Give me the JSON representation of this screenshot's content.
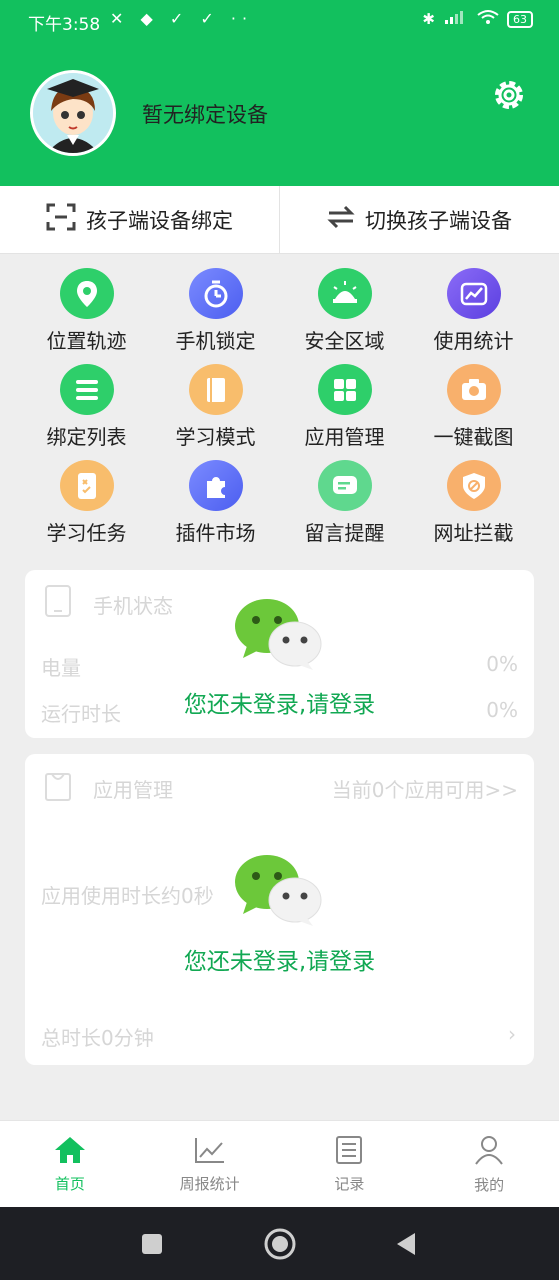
{
  "status": {
    "time": "下午3:58",
    "left_icons": "✕ ◆ ✓ ✓ ··",
    "battery": "63"
  },
  "header": {
    "device_title": "暂无绑定设备",
    "accent": "#12c05e"
  },
  "bind": {
    "bind_label": "孩子端设备绑定",
    "switch_label": "切换孩子端设备"
  },
  "features": [
    {
      "label": "位置轨迹",
      "icon": "location-pin-icon"
    },
    {
      "label": "手机锁定",
      "icon": "timer-icon"
    },
    {
      "label": "安全区域",
      "icon": "radar-icon"
    },
    {
      "label": "使用统计",
      "icon": "trend-chart-icon"
    },
    {
      "label": "绑定列表",
      "icon": "list-icon"
    },
    {
      "label": "学习模式",
      "icon": "book-icon"
    },
    {
      "label": "应用管理",
      "icon": "app-grid-icon"
    },
    {
      "label": "一键截图",
      "icon": "camera-icon"
    },
    {
      "label": "学习任务",
      "icon": "task-note-icon"
    },
    {
      "label": "插件市场",
      "icon": "puzzle-icon"
    },
    {
      "label": "留言提醒",
      "icon": "message-icon"
    },
    {
      "label": "网址拦截",
      "icon": "block-shield-icon"
    }
  ],
  "phone_status": {
    "title": "手机状态",
    "battery_label": "电量",
    "battery_value": "0%",
    "runtime_label": "运行时长",
    "runtime_value": "0%",
    "login_prompt": "您还未登录,请登录"
  },
  "app_manage": {
    "title": "应用管理",
    "available": "当前0个应用可用>>",
    "usage": "应用使用时长约0秒",
    "total": "总时长0分钟",
    "login_prompt": "您还未登录,请登录"
  },
  "tabs": [
    {
      "label": "首页",
      "icon": "home-icon",
      "active": true
    },
    {
      "label": "周报统计",
      "icon": "line-chart-icon",
      "active": false
    },
    {
      "label": "记录",
      "icon": "record-doc-icon",
      "active": false
    },
    {
      "label": "我的",
      "icon": "user-icon",
      "active": false
    }
  ]
}
